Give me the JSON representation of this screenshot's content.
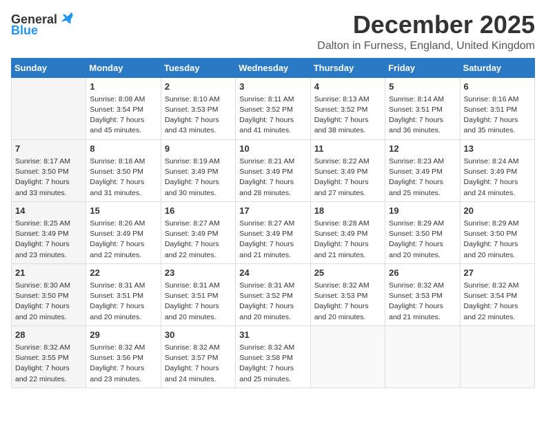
{
  "logo": {
    "general": "General",
    "blue": "Blue"
  },
  "title": {
    "month": "December 2025",
    "location": "Dalton in Furness, England, United Kingdom"
  },
  "weekdays": [
    "Sunday",
    "Monday",
    "Tuesday",
    "Wednesday",
    "Thursday",
    "Friday",
    "Saturday"
  ],
  "weeks": [
    [
      {
        "day": "",
        "info": ""
      },
      {
        "day": "1",
        "info": "Sunrise: 8:08 AM\nSunset: 3:54 PM\nDaylight: 7 hours\nand 45 minutes."
      },
      {
        "day": "2",
        "info": "Sunrise: 8:10 AM\nSunset: 3:53 PM\nDaylight: 7 hours\nand 43 minutes."
      },
      {
        "day": "3",
        "info": "Sunrise: 8:11 AM\nSunset: 3:52 PM\nDaylight: 7 hours\nand 41 minutes."
      },
      {
        "day": "4",
        "info": "Sunrise: 8:13 AM\nSunset: 3:52 PM\nDaylight: 7 hours\nand 38 minutes."
      },
      {
        "day": "5",
        "info": "Sunrise: 8:14 AM\nSunset: 3:51 PM\nDaylight: 7 hours\nand 36 minutes."
      },
      {
        "day": "6",
        "info": "Sunrise: 8:16 AM\nSunset: 3:51 PM\nDaylight: 7 hours\nand 35 minutes."
      }
    ],
    [
      {
        "day": "7",
        "info": "Sunrise: 8:17 AM\nSunset: 3:50 PM\nDaylight: 7 hours\nand 33 minutes."
      },
      {
        "day": "8",
        "info": "Sunrise: 8:18 AM\nSunset: 3:50 PM\nDaylight: 7 hours\nand 31 minutes."
      },
      {
        "day": "9",
        "info": "Sunrise: 8:19 AM\nSunset: 3:49 PM\nDaylight: 7 hours\nand 30 minutes."
      },
      {
        "day": "10",
        "info": "Sunrise: 8:21 AM\nSunset: 3:49 PM\nDaylight: 7 hours\nand 28 minutes."
      },
      {
        "day": "11",
        "info": "Sunrise: 8:22 AM\nSunset: 3:49 PM\nDaylight: 7 hours\nand 27 minutes."
      },
      {
        "day": "12",
        "info": "Sunrise: 8:23 AM\nSunset: 3:49 PM\nDaylight: 7 hours\nand 25 minutes."
      },
      {
        "day": "13",
        "info": "Sunrise: 8:24 AM\nSunset: 3:49 PM\nDaylight: 7 hours\nand 24 minutes."
      }
    ],
    [
      {
        "day": "14",
        "info": "Sunrise: 8:25 AM\nSunset: 3:49 PM\nDaylight: 7 hours\nand 23 minutes."
      },
      {
        "day": "15",
        "info": "Sunrise: 8:26 AM\nSunset: 3:49 PM\nDaylight: 7 hours\nand 22 minutes."
      },
      {
        "day": "16",
        "info": "Sunrise: 8:27 AM\nSunset: 3:49 PM\nDaylight: 7 hours\nand 22 minutes."
      },
      {
        "day": "17",
        "info": "Sunrise: 8:27 AM\nSunset: 3:49 PM\nDaylight: 7 hours\nand 21 minutes."
      },
      {
        "day": "18",
        "info": "Sunrise: 8:28 AM\nSunset: 3:49 PM\nDaylight: 7 hours\nand 21 minutes."
      },
      {
        "day": "19",
        "info": "Sunrise: 8:29 AM\nSunset: 3:50 PM\nDaylight: 7 hours\nand 20 minutes."
      },
      {
        "day": "20",
        "info": "Sunrise: 8:29 AM\nSunset: 3:50 PM\nDaylight: 7 hours\nand 20 minutes."
      }
    ],
    [
      {
        "day": "21",
        "info": "Sunrise: 8:30 AM\nSunset: 3:50 PM\nDaylight: 7 hours\nand 20 minutes."
      },
      {
        "day": "22",
        "info": "Sunrise: 8:31 AM\nSunset: 3:51 PM\nDaylight: 7 hours\nand 20 minutes."
      },
      {
        "day": "23",
        "info": "Sunrise: 8:31 AM\nSunset: 3:51 PM\nDaylight: 7 hours\nand 20 minutes."
      },
      {
        "day": "24",
        "info": "Sunrise: 8:31 AM\nSunset: 3:52 PM\nDaylight: 7 hours\nand 20 minutes."
      },
      {
        "day": "25",
        "info": "Sunrise: 8:32 AM\nSunset: 3:53 PM\nDaylight: 7 hours\nand 20 minutes."
      },
      {
        "day": "26",
        "info": "Sunrise: 8:32 AM\nSunset: 3:53 PM\nDaylight: 7 hours\nand 21 minutes."
      },
      {
        "day": "27",
        "info": "Sunrise: 8:32 AM\nSunset: 3:54 PM\nDaylight: 7 hours\nand 22 minutes."
      }
    ],
    [
      {
        "day": "28",
        "info": "Sunrise: 8:32 AM\nSunset: 3:55 PM\nDaylight: 7 hours\nand 22 minutes."
      },
      {
        "day": "29",
        "info": "Sunrise: 8:32 AM\nSunset: 3:56 PM\nDaylight: 7 hours\nand 23 minutes."
      },
      {
        "day": "30",
        "info": "Sunrise: 8:32 AM\nSunset: 3:57 PM\nDaylight: 7 hours\nand 24 minutes."
      },
      {
        "day": "31",
        "info": "Sunrise: 8:32 AM\nSunset: 3:58 PM\nDaylight: 7 hours\nand 25 minutes."
      },
      {
        "day": "",
        "info": ""
      },
      {
        "day": "",
        "info": ""
      },
      {
        "day": "",
        "info": ""
      }
    ]
  ]
}
